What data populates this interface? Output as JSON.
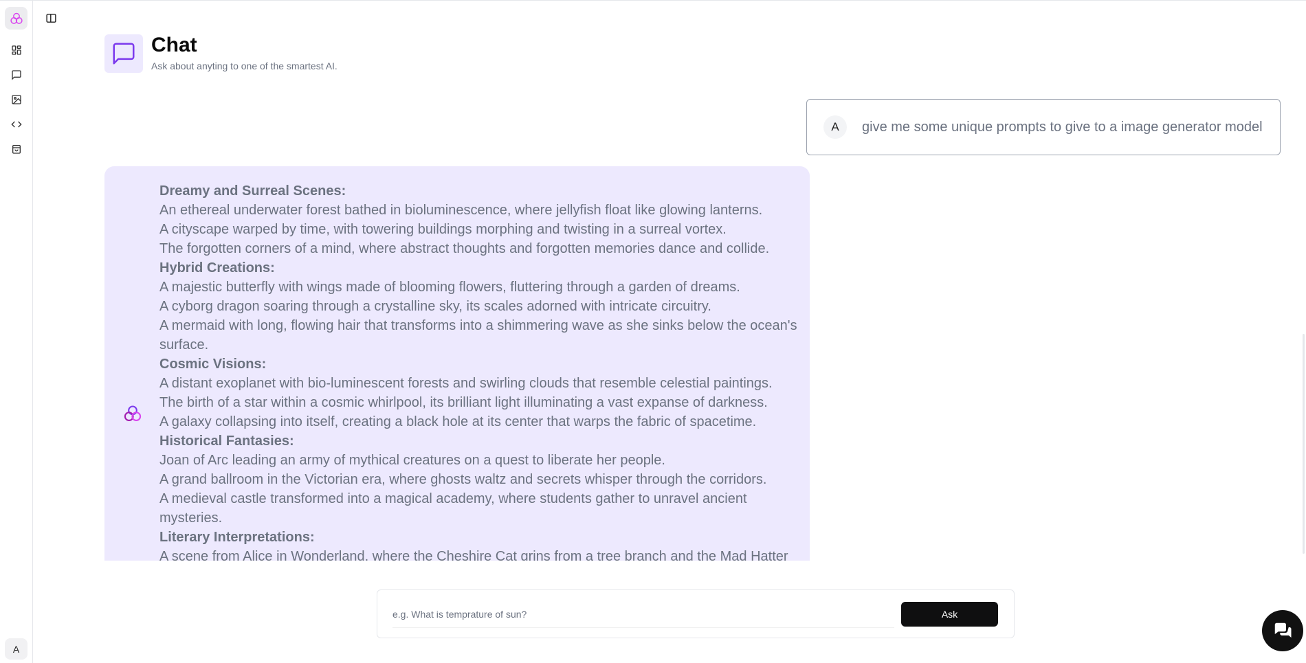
{
  "header": {
    "title": "Chat",
    "subtitle": "Ask about anyting to one of the smartest AI."
  },
  "sidebar": {
    "items": [
      {
        "icon": "dashboard-icon"
      },
      {
        "icon": "message-icon"
      },
      {
        "icon": "image-icon"
      },
      {
        "icon": "code-icon"
      },
      {
        "icon": "bag-icon"
      }
    ],
    "user_initial": "A"
  },
  "conversation": {
    "user_message": {
      "initial": "A",
      "text": "give me some unique prompts to give to a image generator model"
    },
    "ai_message": {
      "sections": [
        {
          "title": "Dreamy and Surreal Scenes:",
          "lines": [
            "An ethereal underwater forest bathed in bioluminescence, where jellyfish float like glowing lanterns.",
            "A cityscape warped by time, with towering buildings morphing and twisting in a surreal vortex.",
            "The forgotten corners of a mind, where abstract thoughts and forgotten memories dance and collide."
          ]
        },
        {
          "title": "Hybrid Creations:",
          "lines": [
            "A majestic butterfly with wings made of blooming flowers, fluttering through a garden of dreams.",
            "A cyborg dragon soaring through a crystalline sky, its scales adorned with intricate circuitry.",
            "A mermaid with long, flowing hair that transforms into a shimmering wave as she sinks below the ocean's surface."
          ]
        },
        {
          "title": "Cosmic Visions:",
          "lines": [
            "A distant exoplanet with bio-luminescent forests and swirling clouds that resemble celestial paintings.",
            "The birth of a star within a cosmic whirlpool, its brilliant light illuminating a vast expanse of darkness.",
            "A galaxy collapsing into itself, creating a black hole at its center that warps the fabric of spacetime."
          ]
        },
        {
          "title": "Historical Fantasies:",
          "lines": [
            "Joan of Arc leading an army of mythical creatures on a quest to liberate her people.",
            "A grand ballroom in the Victorian era, where ghosts waltz and secrets whisper through the corridors.",
            "A medieval castle transformed into a magical academy, where students gather to unravel ancient mysteries."
          ]
        },
        {
          "title": "Literary Interpretations:",
          "lines": [
            "A scene from Alice in Wonderland, where the Cheshire Cat grins from a tree branch and the Mad Hatter"
          ]
        }
      ]
    }
  },
  "composer": {
    "placeholder": "e.g. What is temprature of sun?",
    "value": "",
    "ask_label": "Ask"
  },
  "colors": {
    "accent": "#7c3aed",
    "ai_bubble": "#ede9fe",
    "button": "#0f0f10"
  }
}
